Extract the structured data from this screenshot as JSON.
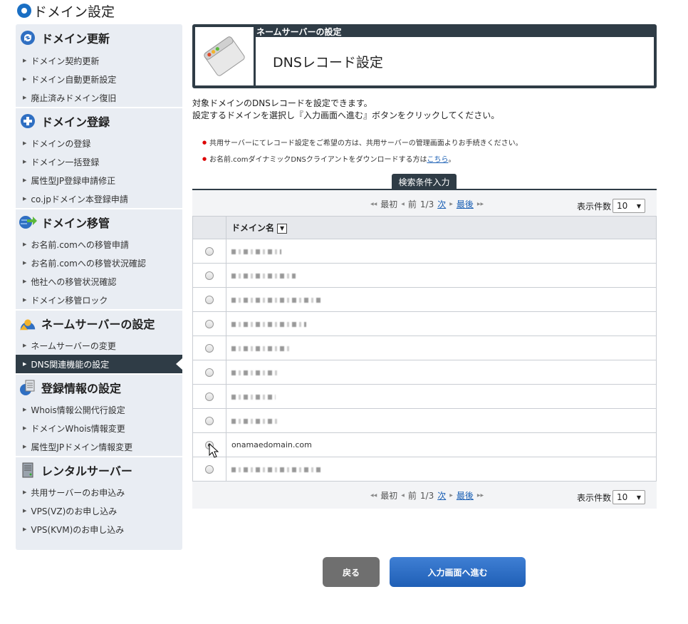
{
  "page_title": "ドメイン設定",
  "sidebar": {
    "sections": [
      {
        "title": "ドメイン更新",
        "icon": "refresh-icon",
        "items": [
          "ドメイン契約更新",
          "ドメイン自動更新設定",
          "廃止済みドメイン復旧"
        ]
      },
      {
        "title": "ドメイン登録",
        "icon": "plus-icon",
        "items": [
          "ドメインの登録",
          "ドメイン一括登録",
          "属性型JP登録申請修正",
          "co.jpドメイン本登録申請"
        ]
      },
      {
        "title": "ドメイン移管",
        "icon": "globe-transfer-icon",
        "items": [
          "お名前.comへの移管申請",
          "お名前.comへの移管状況確認",
          "他社への移管状況確認",
          "ドメイン移管ロック"
        ]
      },
      {
        "title": "ネームサーバーの設定",
        "icon": "nameserver-icon",
        "items": [
          "ネームサーバーの変更",
          "DNS関連機能の設定"
        ]
      },
      {
        "title": "登録情報の設定",
        "icon": "document-icon",
        "items": [
          "Whois情報公開代行設定",
          "ドメインWhois情報変更",
          "属性型JPドメイン情報変更"
        ]
      },
      {
        "title": "レンタルサーバー",
        "icon": "server-icon",
        "items": [
          "共用サーバーのお申込み",
          "VPS(VZ)のお申し込み",
          "VPS(KVM)のお申し込み"
        ]
      }
    ],
    "active_item": "DNS関連機能の設定"
  },
  "header": {
    "subtitle": "ネームサーバーの設定",
    "title": "DNSレコード設定",
    "icon": "browser-window-icon"
  },
  "description": {
    "line1": "対象ドメインのDNSレコードを設定できます。",
    "line2": "設定するドメインを選択し『入力画面へ進む』ボタンをクリックしてください。"
  },
  "notes": {
    "note1": "共用サーバーにてレコード設定をご希望の方は、共用サーバーの管理画面よりお手続きください。",
    "note2_prefix": "お名前.comダイナミックDNSクライアントをダウンロードする方は",
    "note2_link": "こちら",
    "note2_suffix": "。"
  },
  "search_tab": "検索条件入力",
  "pager": {
    "first": "最初",
    "prev": "前",
    "page": "1/3",
    "next": "次",
    "last": "最後",
    "count_label": "表示件数",
    "count_value": "10"
  },
  "table": {
    "header_domain": "ドメイン名",
    "rows": [
      {
        "domain": "",
        "redacted": true,
        "checked": false
      },
      {
        "domain": "",
        "redacted": true,
        "checked": false
      },
      {
        "domain": "",
        "redacted": true,
        "checked": false
      },
      {
        "domain": "",
        "redacted": true,
        "checked": false
      },
      {
        "domain": "",
        "redacted": true,
        "checked": false
      },
      {
        "domain": "",
        "redacted": true,
        "checked": false
      },
      {
        "domain": "",
        "redacted": true,
        "checked": false
      },
      {
        "domain": "",
        "redacted": true,
        "checked": false
      },
      {
        "domain": "onamaedomain.com",
        "redacted": false,
        "checked": true
      },
      {
        "domain": "",
        "redacted": true,
        "checked": false
      }
    ]
  },
  "buttons": {
    "back": "戻る",
    "next": "入力画面へ進む"
  }
}
